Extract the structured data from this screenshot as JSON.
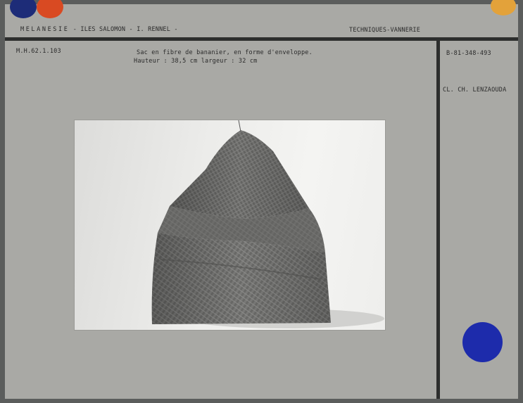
{
  "header": {
    "region": "MELANESIE",
    "location": "- ILES SALOMON - I. RENNEL -",
    "category": "TECHNIQUES-VANNERIE"
  },
  "record": {
    "inventory_number": "M.H.62.1.103",
    "description_line1": "Sac en fibre de bananier, en forme d'enveloppe.",
    "description_line2": "Hauteur : 38,5 cm largeur : 32 cm",
    "photo_reference": "B-81-348-493",
    "photo_credit": "CL. CH. LENZAOUDA"
  },
  "colors": {
    "card": "#a9a9a5",
    "rule": "#2d2e2d",
    "dot_navy": "#1d2c78",
    "dot_orange": "#d94a22",
    "dot_yellow": "#e3a23a",
    "dot_blue": "#1d2bab"
  },
  "photo": {
    "subject": "woven banana-fibre envelope-shaped bag"
  }
}
